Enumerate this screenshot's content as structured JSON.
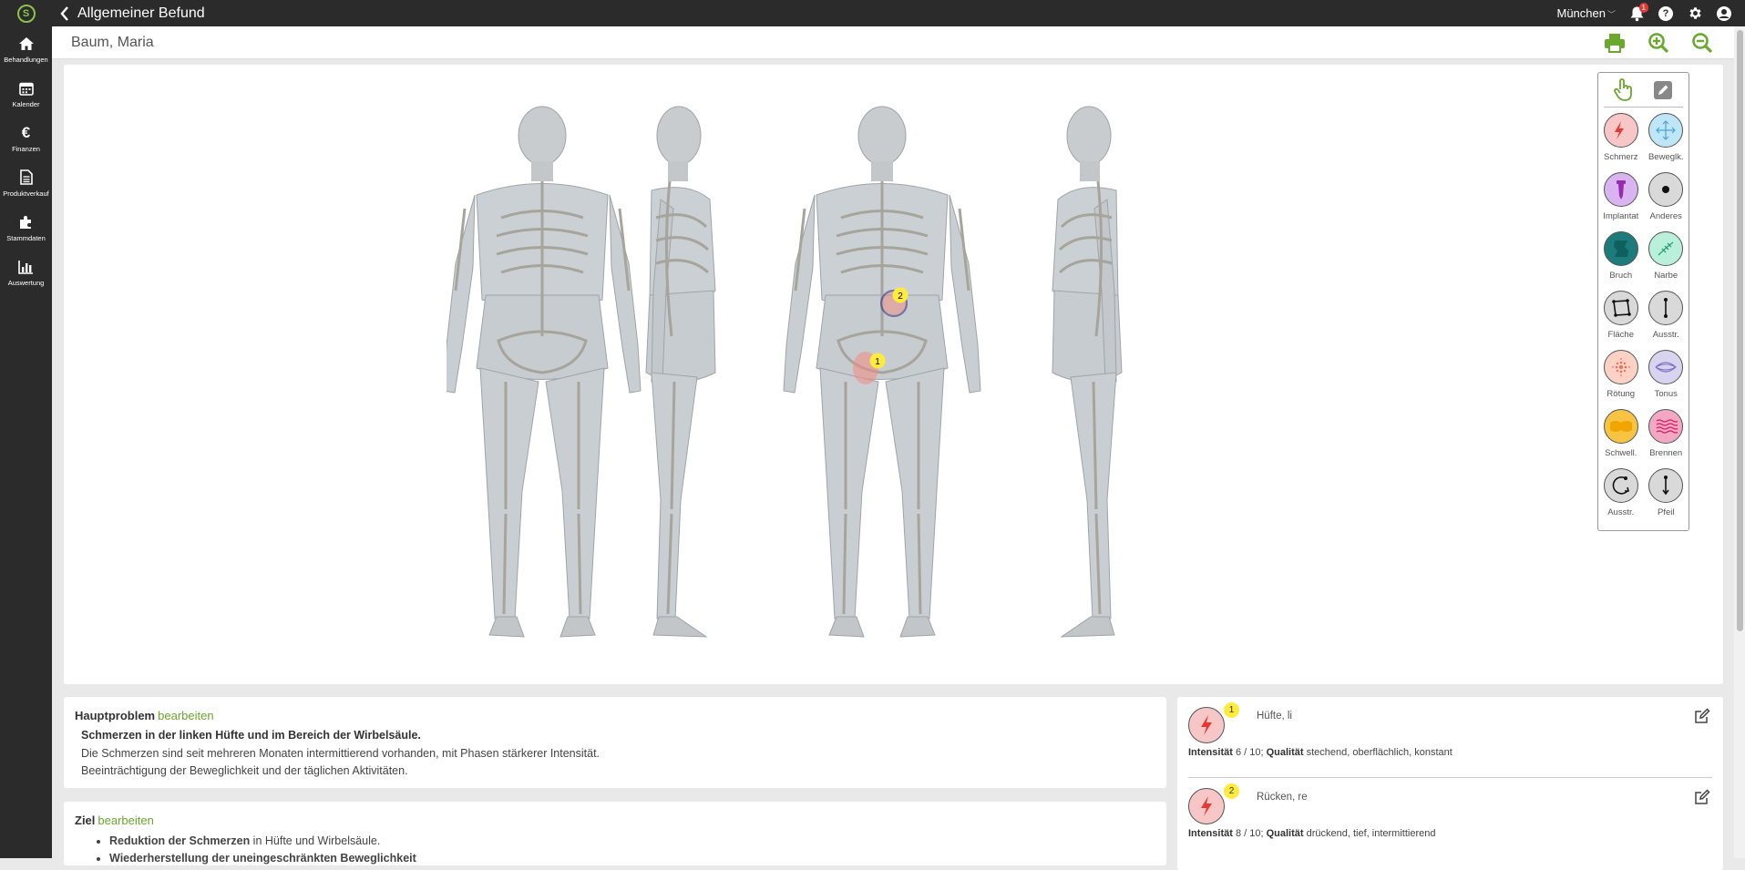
{
  "app": {
    "title": "Allgemeiner Befund",
    "location": "München",
    "notification_count": "1"
  },
  "nav": [
    {
      "label": "Behandlungen",
      "icon": "home-icon"
    },
    {
      "label": "Kalender",
      "icon": "calendar-icon"
    },
    {
      "label": "Finanzen",
      "icon": "euro-icon"
    },
    {
      "label": "Produktverkauf",
      "icon": "document-icon"
    },
    {
      "label": "Stammdaten",
      "icon": "puzzle-icon"
    },
    {
      "label": "Auswertung",
      "icon": "bar-chart-icon"
    }
  ],
  "patient": {
    "name": "Baum, Maria"
  },
  "palette": [
    {
      "label": "Schmerz",
      "icon": "lightning-icon",
      "color": "#f7c6c6"
    },
    {
      "label": "Beweglk.",
      "icon": "move-arrows-icon",
      "color": "#bfe6f7"
    },
    {
      "label": "Implantat",
      "icon": "screw-icon",
      "color": "#d8b4f0"
    },
    {
      "label": "Anderes",
      "icon": "dot-icon",
      "color": "#d9d9d9"
    },
    {
      "label": "Bruch",
      "icon": "fracture-icon",
      "color": "#1e7b7b"
    },
    {
      "label": "Narbe",
      "icon": "scar-icon",
      "color": "#b9f0dc"
    },
    {
      "label": "Fläche",
      "icon": "area-icon",
      "color": "#d9d9d9"
    },
    {
      "label": "Ausstr.",
      "icon": "line-icon",
      "color": "#d9d9d9"
    },
    {
      "label": "Rötung",
      "icon": "redness-icon",
      "color": "#fdd2c4"
    },
    {
      "label": "Tonus",
      "icon": "tonus-icon",
      "color": "#d8d4f0"
    },
    {
      "label": "Schwell.",
      "icon": "swelling-icon",
      "color": "#f6c342"
    },
    {
      "label": "Brennen",
      "icon": "burning-icon",
      "color": "#f2a7c3"
    },
    {
      "label": "Ausstr.",
      "icon": "curve-arrow-icon",
      "color": "#d9d9d9"
    },
    {
      "label": "Pfeil",
      "icon": "arrow-icon",
      "color": "#d9d9d9"
    }
  ],
  "markers": [
    {
      "num": "1"
    },
    {
      "num": "2"
    }
  ],
  "hauptproblem": {
    "title": "Hauptproblem",
    "edit": "bearbeiten",
    "summary": "Schmerzen in der linken Hüfte und im Bereich der Wirbelsäule.",
    "lines": [
      "Die Schmerzen sind seit mehreren Monaten intermittierend vorhanden, mit Phasen stärkerer Intensität.",
      "Beeinträchtigung der Beweglichkeit und der täglichen Aktivitäten."
    ]
  },
  "ziel": {
    "title": "Ziel",
    "edit": "bearbeiten",
    "items": [
      {
        "bold": "Reduktion der Schmerzen",
        "rest": " in Hüfte und Wirbelsäule."
      },
      {
        "bold": "Wiederherstellung der uneingeschränkten Beweglichkeit",
        "rest": ""
      }
    ]
  },
  "entries": [
    {
      "num": "1",
      "location": "Hüfte, li",
      "intensity_label": "Intensität",
      "intensity": "6 / 10;",
      "quality_label": "Qualität",
      "quality": "stechend, oberflächlich, konstant"
    },
    {
      "num": "2",
      "location": "Rücken, re",
      "intensity_label": "Intensität",
      "intensity": "8 / 10;",
      "quality_label": "Qualität",
      "quality": "drückend, tief, intermittierend"
    }
  ]
}
